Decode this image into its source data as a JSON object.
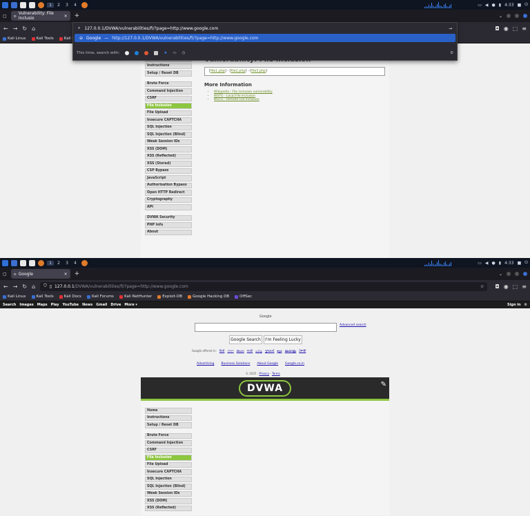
{
  "taskbar": {
    "workspaces": [
      "1",
      "2",
      "3",
      "4"
    ],
    "clock": "4:33"
  },
  "shot1": {
    "tab_title": "Vulnerability: File Inclusio",
    "bookmarks": [
      "Kali Linux",
      "Kali Tools",
      "Kali Do"
    ],
    "dropdown": {
      "typed_url": "127.0.0.1/DVWA/vulnerabilities/fi/?page=http://www.google.com",
      "suggestion_engine": "Google",
      "suggestion_sep": "—",
      "suggestion_url": "http://127.0.0.1/DVWA/vulnerabilities/fi/?page=http://www.google.com",
      "search_with": "This time, search with:"
    }
  },
  "shot2": {
    "tab_title": "Google",
    "url_host": "127.0.0.1",
    "url_path": "/DVWA/vulnerabilities/fi/?page=http://www.google.com",
    "bookmarks": [
      "Kali Linux",
      "Kali Tools",
      "Kali Docs",
      "Kali Forums",
      "Kali NetHunter",
      "Exploit-DB",
      "Google Hacking DB",
      "OffSec"
    ],
    "google_bar": [
      "Search",
      "Images",
      "Maps",
      "Play",
      "YouTube",
      "News",
      "Gmail",
      "Drive",
      "More"
    ],
    "google_signin": "Sign in",
    "google_logo_text": "Google",
    "advanced_search": "Advanced search",
    "search_button": "Google Search",
    "lucky_button": "I'm Feeling Lucky",
    "offered_label": "Google offered in:",
    "offered_langs": [
      "हिन्दी",
      "বাংলা",
      "తెలుగు",
      "मराठी",
      "தமிழ்",
      "ગુજરાતી",
      "ಕನ್ನಡ",
      "മലയാളം",
      "ਪੰਜਾਬੀ"
    ],
    "footer_links": [
      "Advertising",
      "Business Solutions",
      "About Google",
      "Google.co.in"
    ],
    "copyright": "© 2025 -",
    "privacy": "Privacy",
    "terms": "Terms"
  },
  "dvwa": {
    "logo": "DVWA",
    "menu_top": [
      "Home",
      "Instructions",
      "Setup / Reset DB"
    ],
    "menu_vulns": [
      "Brute Force",
      "Command Injection",
      "CSRF",
      "File Inclusion",
      "File Upload",
      "Insecure CAPTCHA",
      "SQL Injection",
      "SQL Injection (Blind)",
      "Weak Session IDs",
      "XSS (DOM)",
      "XSS (Reflected)",
      "XSS (Stored)",
      "CSP Bypass",
      "JavaScript",
      "Authorisation Bypass",
      "Open HTTP Redirect",
      "Cryptography",
      "API"
    ],
    "menu_bottom": [
      "DVWA Security",
      "PHP Info",
      "About"
    ],
    "selected": "File Inclusion",
    "title": "Vulnerability: File Inclusion",
    "files": [
      "file1.php",
      "file2.php",
      "file3.php"
    ],
    "more_title": "More Information",
    "more_links": [
      "Wikipedia - File inclusion vulnerability",
      "WSTG - Local File Inclusion",
      "WSTG - Remote File Inclusion"
    ]
  },
  "colors": {
    "dvwa_accent": "#8dc63f",
    "taskbar_bg": "#0f1521",
    "suggest_highlight": "#2a61c9"
  }
}
